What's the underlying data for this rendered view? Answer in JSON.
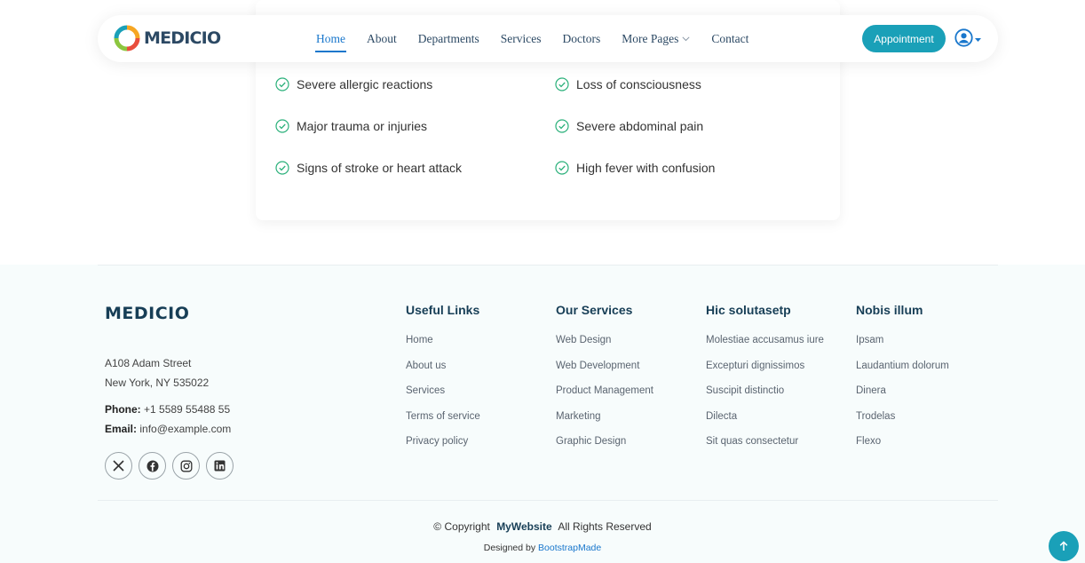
{
  "header": {
    "logo_text": "MEDICIO",
    "nav": [
      {
        "label": "Home"
      },
      {
        "label": "About"
      },
      {
        "label": "Departments"
      },
      {
        "label": "Services"
      },
      {
        "label": "Doctors"
      },
      {
        "label": "More Pages"
      },
      {
        "label": "Contact"
      }
    ],
    "active_nav": "Home",
    "appointment_label": "Appointment"
  },
  "emergency_conditions": [
    "Severe allergic reactions",
    "Loss of consciousness",
    "Major trauma or injuries",
    "Severe abdominal pain",
    "Signs of stroke or heart attack",
    "High fever with confusion"
  ],
  "footer": {
    "brand": "MEDICIO",
    "address_line1": "A108 Adam Street",
    "address_line2": "New York, NY 535022",
    "phone_label": "Phone:",
    "phone": "+1 5589 55488 55",
    "email_label": "Email:",
    "email": "info@example.com",
    "columns": [
      {
        "title": "Useful Links",
        "links": [
          "Home",
          "About us",
          "Services",
          "Terms of service",
          "Privacy policy"
        ]
      },
      {
        "title": "Our Services",
        "links": [
          "Web Design",
          "Web Development",
          "Product Management",
          "Marketing",
          "Graphic Design"
        ]
      },
      {
        "title": "Hic solutasetp",
        "links": [
          "Molestiae accusamus iure",
          "Excepturi dignissimos",
          "Suscipit distinctio",
          "Dilecta",
          "Sit quas consectetur"
        ]
      },
      {
        "title": "Nobis illum",
        "links": [
          "Ipsam",
          "Laudantium dolorum",
          "Dinera",
          "Trodelas",
          "Flexo"
        ]
      }
    ],
    "copyright_prefix": "© Copyright",
    "site_name": "MyWebsite",
    "rights": "All Rights Reserved",
    "designed_by": "Designed by",
    "designer": "BootstrapMade"
  },
  "colors": {
    "accent": "#1977cc",
    "button": "#1aa0b8",
    "heading": "#2c4964",
    "check": "#2ab07a"
  },
  "icons": {
    "social": [
      "x-icon",
      "facebook-icon",
      "instagram-icon",
      "linkedin-icon"
    ]
  }
}
